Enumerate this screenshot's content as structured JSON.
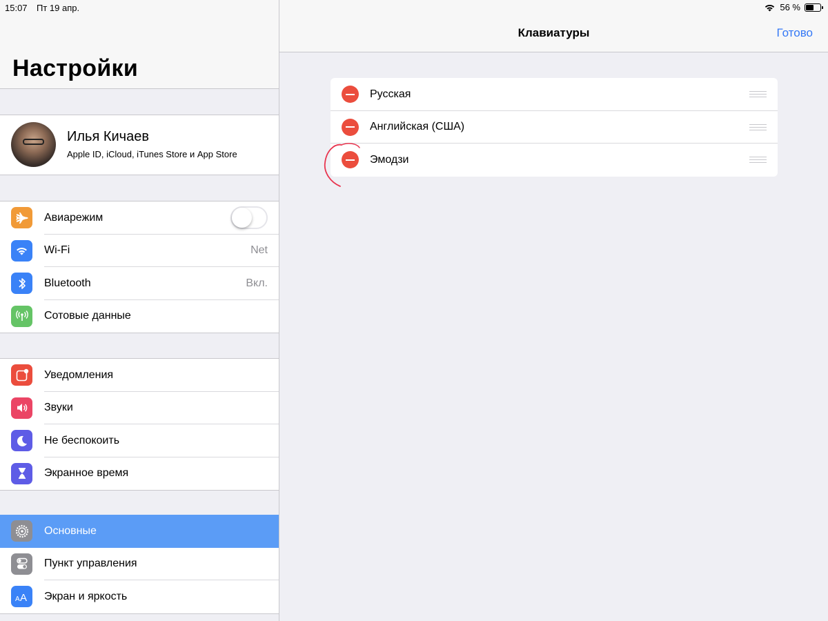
{
  "status_bar": {
    "time": "15:07",
    "date": "Пт 19 апр.",
    "battery": "56 %",
    "battery_level": 0.56
  },
  "master": {
    "title": "Настройки",
    "profile": {
      "name": "Илья Кичаев",
      "subtitle": "Apple ID, iCloud, iTunes Store и App Store"
    },
    "groups": [
      {
        "items": [
          {
            "label": "Авиарежим",
            "icon": "airplane-icon",
            "icon_color": "#f19a37",
            "control": "toggle",
            "on": false
          },
          {
            "label": "Wi-Fi",
            "icon": "wifi-icon",
            "icon_color": "#3a82f7",
            "value": "Net"
          },
          {
            "label": "Bluetooth",
            "icon": "bluetooth-icon",
            "icon_color": "#3a82f7",
            "value": "Вкл."
          },
          {
            "label": "Сотовые данные",
            "icon": "cellular-icon",
            "icon_color": "#65c466"
          }
        ]
      },
      {
        "items": [
          {
            "label": "Уведомления",
            "icon": "notifications-icon",
            "icon_color": "#eb4d3d"
          },
          {
            "label": "Звуки",
            "icon": "speaker-icon",
            "icon_color": "#eb4565"
          },
          {
            "label": "Не беспокоить",
            "icon": "moon-icon",
            "icon_color": "#5e5ce6"
          },
          {
            "label": "Экранное время",
            "icon": "hourglass-icon",
            "icon_color": "#5e5ce6"
          }
        ]
      },
      {
        "items": [
          {
            "label": "Основные",
            "icon": "gear-icon",
            "icon_color": "#8e8e93",
            "selected": true
          },
          {
            "label": "Пункт управления",
            "icon": "switches-icon",
            "icon_color": "#8e8e93"
          },
          {
            "label": "Экран и яркость",
            "icon": "text-size-icon",
            "icon_color": "#3a82f7"
          }
        ]
      }
    ]
  },
  "detail": {
    "title": "Клавиатуры",
    "done_label": "Готово",
    "keyboards": [
      {
        "label": "Русская"
      },
      {
        "label": "Английская (США)"
      },
      {
        "label": "Эмодзи"
      }
    ]
  },
  "colors": {
    "accent": "#3478f6",
    "delete_red": "#eb4d3d",
    "selection": "#5b9cf6",
    "annotation": "#e8344e"
  }
}
